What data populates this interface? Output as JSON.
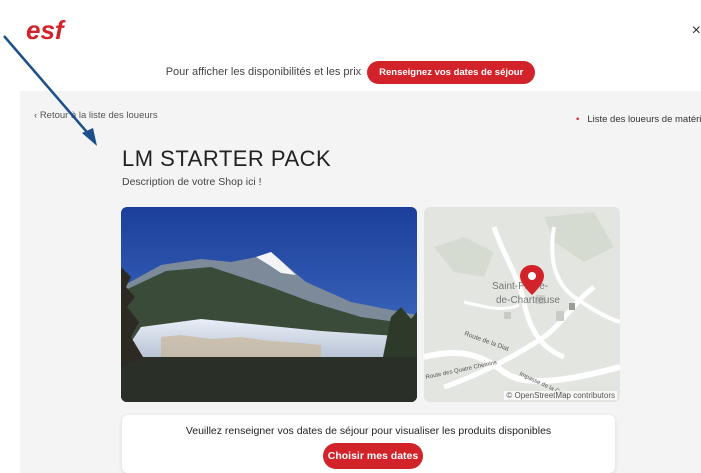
{
  "header": {
    "logo_text": "esf",
    "close_icon": "close-icon",
    "close_glyph": "×"
  },
  "availability": {
    "text": "Pour afficher les disponibilités et les prix",
    "button_label": "Renseignez vos dates de séjour"
  },
  "nav": {
    "back_chevron": "‹",
    "back_label": "Retour à la liste des loueurs",
    "right_bullet": "•",
    "right_label": "Liste des loueurs de matériel"
  },
  "shop": {
    "title": "LM STARTER PACK",
    "description": "Description de votre Shop ici !"
  },
  "map": {
    "place_name_line1": "Saint-Pierre-",
    "place_name_line2": "de-Chartreuse",
    "road_label_1": "Route de la Diat",
    "road_label_2": "Impasse de la Cotte",
    "road_label_3": "Route des Quatre Chemins",
    "attribution": "© OpenStreetMap contributors"
  },
  "dates_card": {
    "message": "Veuillez renseigner vos dates de séjour pour visualiser les produits disponibles",
    "button_label": "Choisir mes dates"
  },
  "colors": {
    "brand": "#d2232a",
    "annotation_arrow": "#1d4f8c"
  }
}
